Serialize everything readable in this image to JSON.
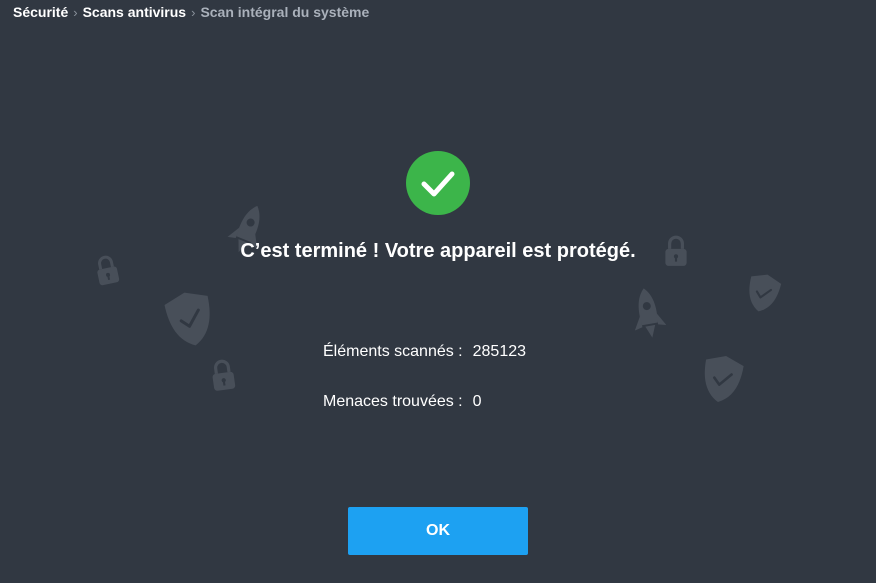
{
  "breadcrumb": {
    "items": [
      "Sécurité",
      "Scans antivirus"
    ],
    "current": "Scan intégral du système",
    "separator": "›"
  },
  "result": {
    "status_icon": "check-circle-icon",
    "title": "C’est terminé ! Votre appareil est protégé."
  },
  "stats": {
    "scanned_label": "Éléments scannés :",
    "scanned_value": "285123",
    "threats_label": "Menaces trouvées :",
    "threats_value": "0"
  },
  "actions": {
    "ok_label": "OK"
  },
  "decorations": [
    "rocket-icon",
    "padlock-icon",
    "shield-check-icon"
  ],
  "colors": {
    "background": "#313842",
    "success": "#3cb54a",
    "button": "#1da1f2",
    "decoration": "#484f59"
  }
}
